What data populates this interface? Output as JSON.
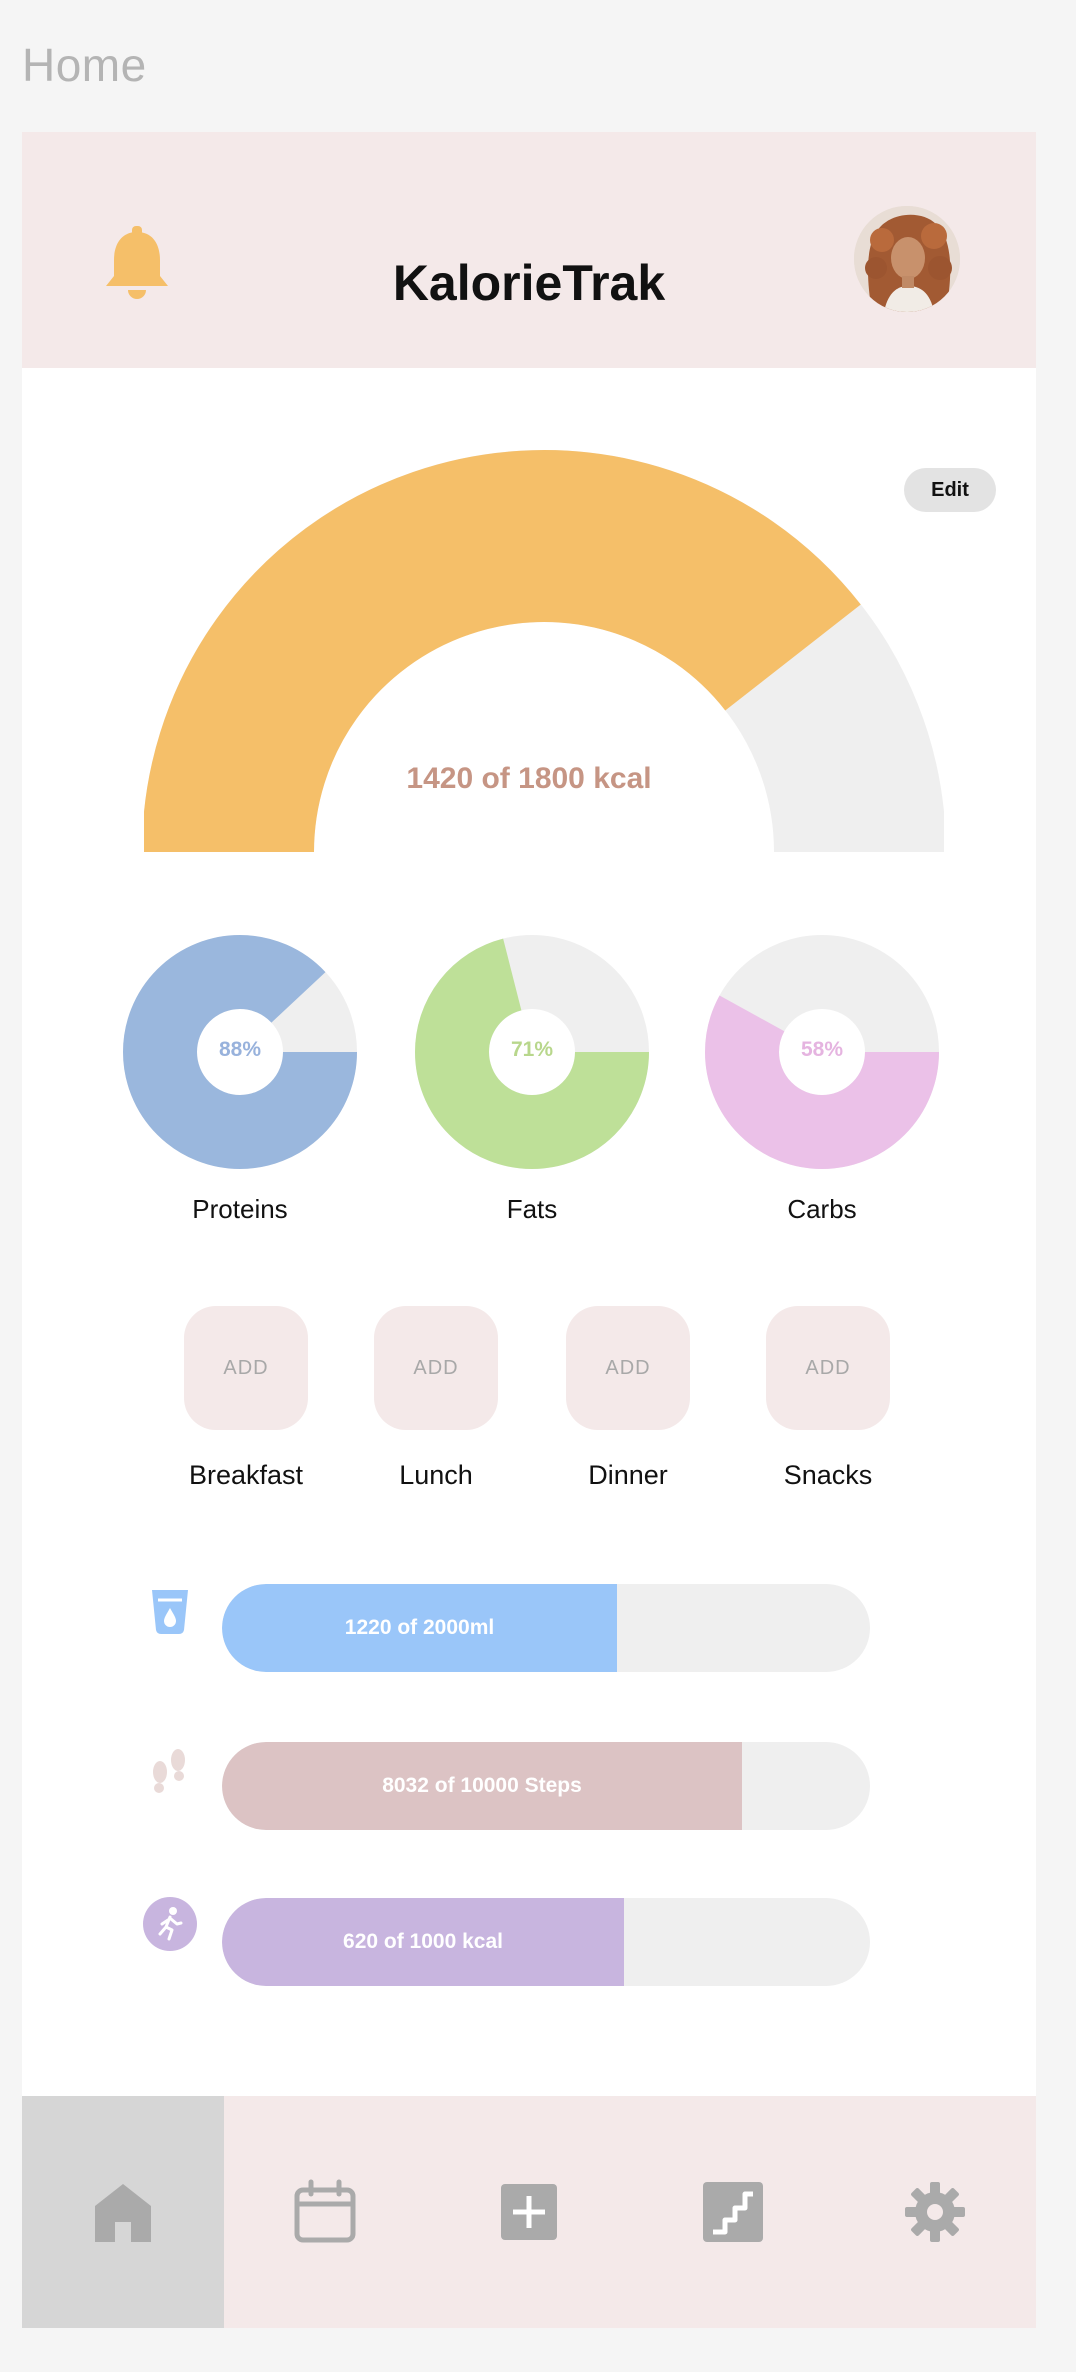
{
  "page": {
    "label": "Home"
  },
  "header": {
    "title": "KalorieTrak",
    "bell_icon": "bell-icon",
    "avatar": "user-avatar"
  },
  "calories": {
    "text": "1420 of 1800 kcal",
    "consumed": 1420,
    "goal": 1800,
    "edit_label": "Edit",
    "colors": {
      "fill": "#f5bf69",
      "track": "#efefef",
      "text": "#c69584"
    }
  },
  "macros": [
    {
      "name": "Proteins",
      "percent": 88,
      "percent_label": "88%",
      "color": "#9ab7dd",
      "text_color": "#98b2dc"
    },
    {
      "name": "Fats",
      "percent": 71,
      "percent_label": "71%",
      "color": "#bee098",
      "text_color": "#b8d78c"
    },
    {
      "name": "Carbs",
      "percent": 58,
      "percent_label": "58%",
      "color": "#ebc1e8",
      "text_color": "#e5b4e0"
    }
  ],
  "meals": [
    {
      "name": "Breakfast",
      "button": "ADD"
    },
    {
      "name": "Lunch",
      "button": "ADD"
    },
    {
      "name": "Dinner",
      "button": "ADD"
    },
    {
      "name": "Snacks",
      "button": "ADD"
    }
  ],
  "trackers": [
    {
      "id": "water",
      "icon": "water-glass-icon",
      "text": "1220 of 2000ml",
      "value": 1220,
      "goal": 2000,
      "color": "#9ac6f9"
    },
    {
      "id": "steps",
      "icon": "footprints-icon",
      "text": "8032 of 10000 Steps",
      "value": 8032,
      "goal": 10000,
      "color": "#dcc3c4"
    },
    {
      "id": "exercise",
      "icon": "running-icon",
      "text": "620 of 1000 kcal",
      "value": 620,
      "goal": 1000,
      "color": "#c8b5df"
    }
  ],
  "nav": [
    {
      "name": "home",
      "icon": "home-icon",
      "active": true
    },
    {
      "name": "calendar",
      "icon": "calendar-icon",
      "active": false
    },
    {
      "name": "add",
      "icon": "add-square-icon",
      "active": false
    },
    {
      "name": "progress",
      "icon": "stairs-icon",
      "active": false
    },
    {
      "name": "settings",
      "icon": "gear-icon",
      "active": false
    }
  ]
}
